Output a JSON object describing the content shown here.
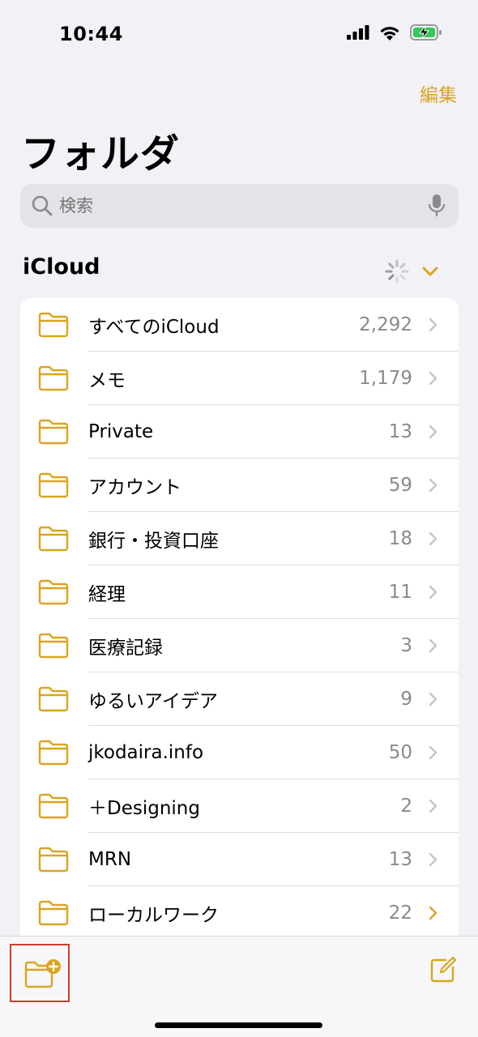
{
  "status": {
    "time": "10:44"
  },
  "nav": {
    "edit_label": "編集",
    "title": "フォルダ"
  },
  "search": {
    "placeholder": "検索"
  },
  "section": {
    "title": "iCloud"
  },
  "folders": [
    {
      "name": "すべてのiCloud",
      "count": "2,292"
    },
    {
      "name": "メモ",
      "count": "1,179"
    },
    {
      "name": "Private",
      "count": "13"
    },
    {
      "name": "アカウント",
      "count": "59"
    },
    {
      "name": "銀行・投資口座",
      "count": "18"
    },
    {
      "name": "経理",
      "count": "11"
    },
    {
      "name": "医療記録",
      "count": "3"
    },
    {
      "name": "ゆるいアイデア",
      "count": "9"
    },
    {
      "name": "jkodaira.info",
      "count": "50"
    },
    {
      "name": "＋Designing",
      "count": "2"
    },
    {
      "name": "MRN",
      "count": "13"
    },
    {
      "name": "ローカルワーク",
      "count": "22"
    }
  ],
  "toolbar": {
    "new_folder_icon": "folder-plus-icon",
    "compose_icon": "compose-icon"
  },
  "colors": {
    "accent": "#d9a521",
    "background": "#f2f1f6",
    "highlight_border": "#d33a2c"
  }
}
